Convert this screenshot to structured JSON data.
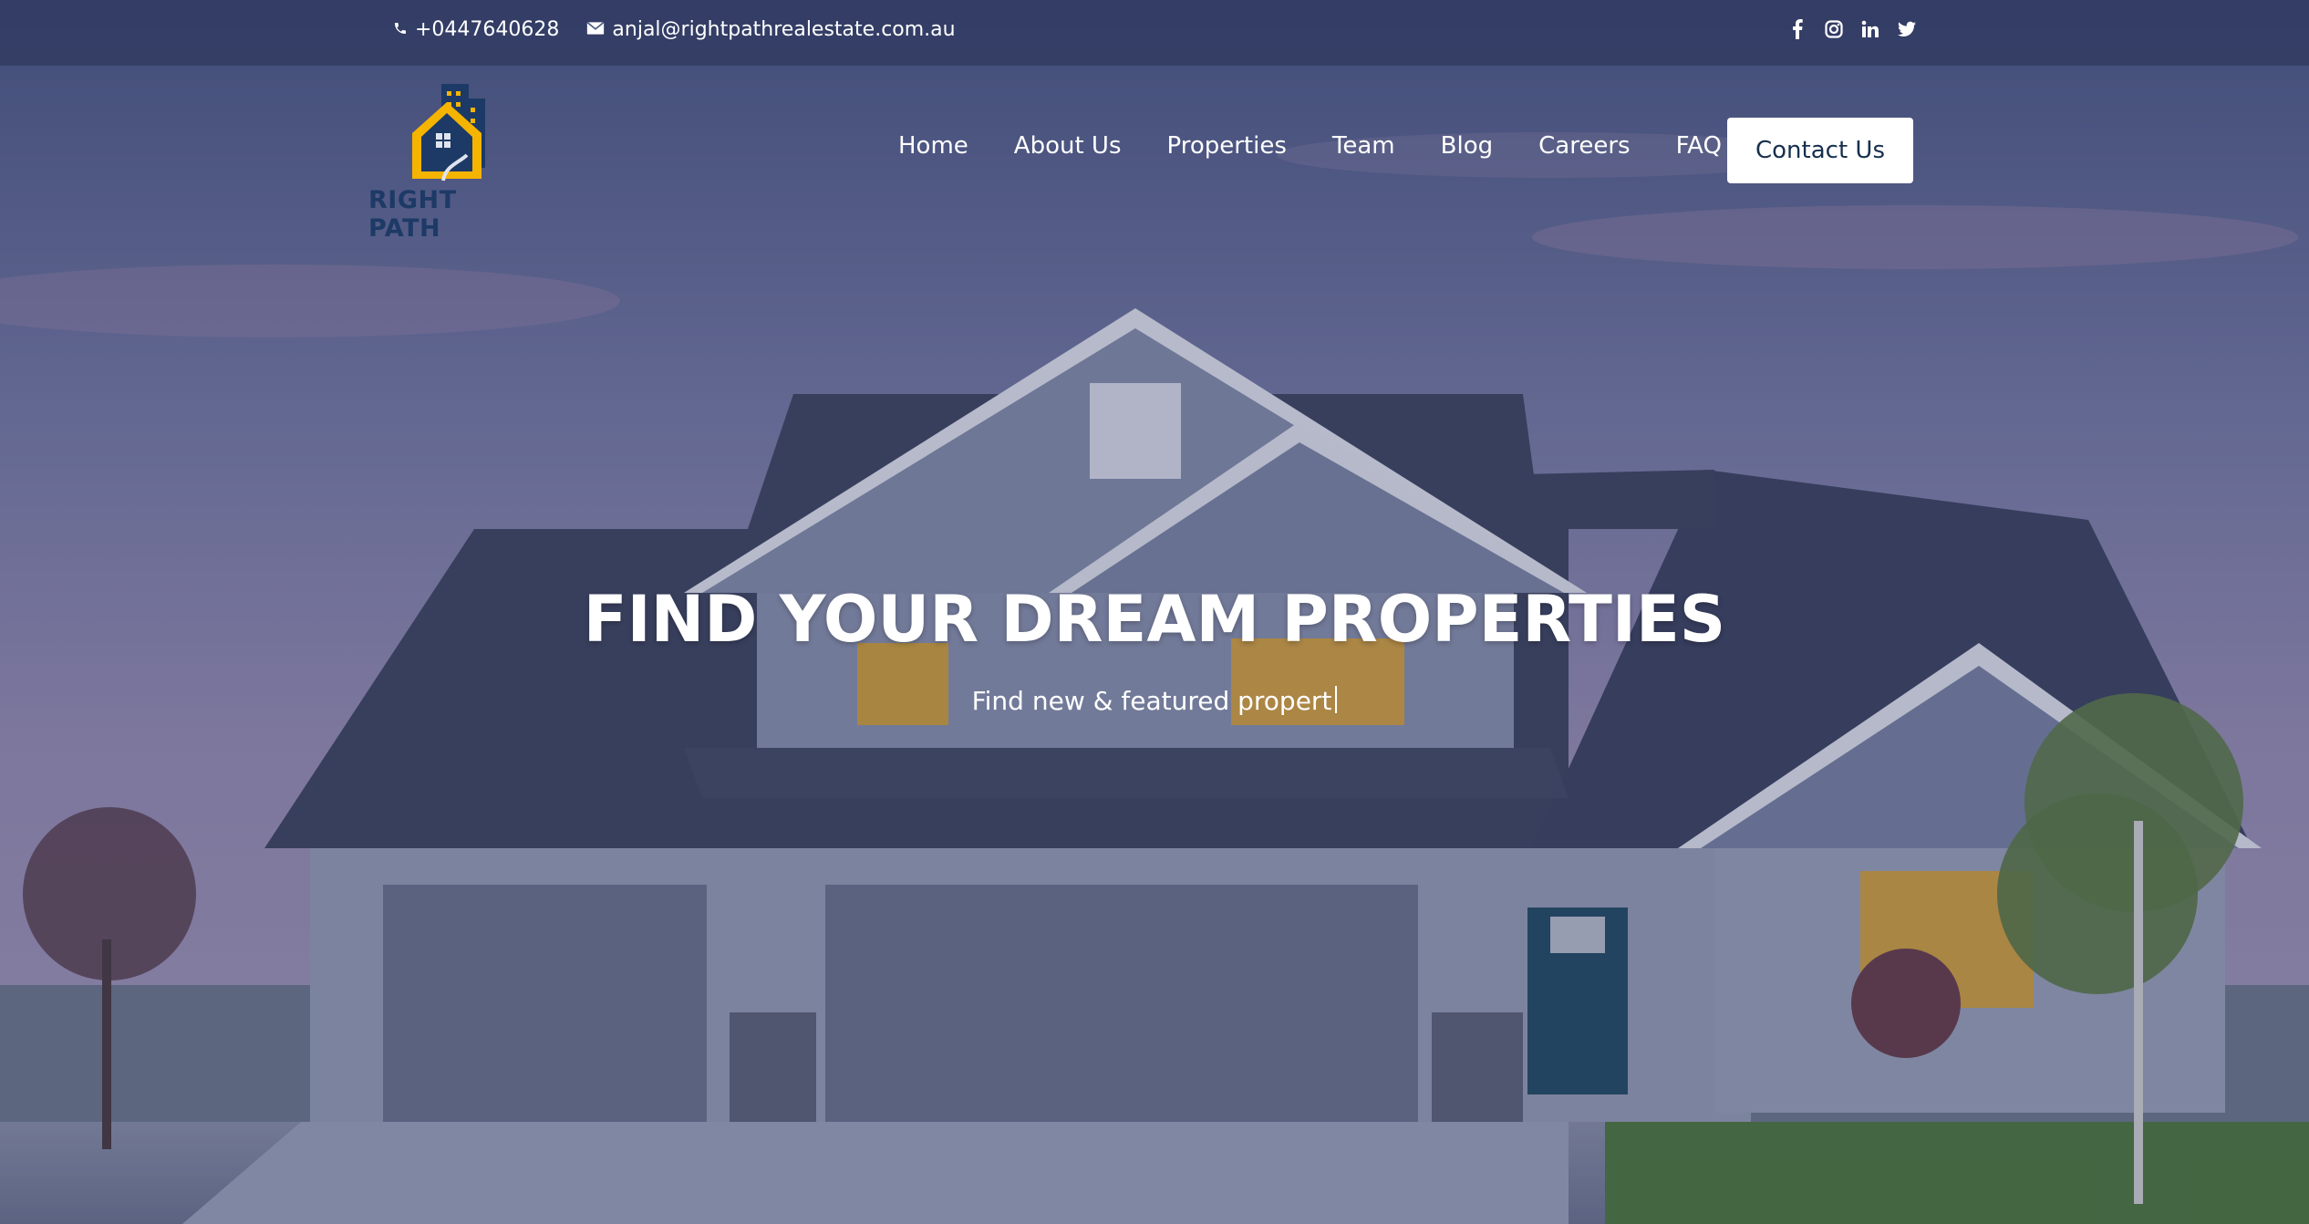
{
  "topbar": {
    "phone": "+0447640628",
    "email": "anjal@rightpathrealestate.com.au",
    "social_icons": [
      "facebook-icon",
      "instagram-icon",
      "linkedin-icon",
      "twitter-icon"
    ]
  },
  "logo": {
    "text": "RIGHT PATH",
    "colors": {
      "navy": "#1d3a67",
      "gold": "#f4b400"
    }
  },
  "nav": {
    "items": [
      {
        "label": "Home"
      },
      {
        "label": "About Us"
      },
      {
        "label": "Properties"
      },
      {
        "label": "Team"
      },
      {
        "label": "Blog"
      },
      {
        "label": "Careers"
      },
      {
        "label": "FAQ"
      }
    ],
    "cta_label": "Contact Us"
  },
  "hero": {
    "title": "FIND YOUR DREAM PROPERTIES",
    "subtitle": "Find new & featured propert"
  }
}
